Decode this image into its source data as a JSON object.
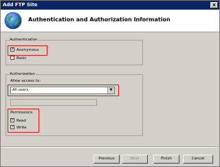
{
  "window": {
    "title": "Add FTP Site",
    "close_glyph": "x"
  },
  "header": {
    "title": "Authentication and Authorization Information",
    "icon": "globe-icon"
  },
  "authentication": {
    "group_label": "Authentication",
    "anonymous": {
      "label": "Anonymous",
      "checked": true
    },
    "basic": {
      "label": "Basic",
      "checked": false
    }
  },
  "authorization": {
    "group_label": "Authorization",
    "allow_access_label": "Allow access to:",
    "allow_access_value": "All users",
    "permissions_label": "Permissions",
    "read": {
      "label": "Read",
      "checked": true
    },
    "write": {
      "label": "Write",
      "checked": true
    }
  },
  "footer": {
    "previous": "Previous",
    "next": "Next",
    "finish": "Finish",
    "cancel": "Cancel"
  },
  "colors": {
    "highlight_red": "#e01818",
    "titlebar": "#0a246a"
  },
  "check_glyph": "✓",
  "dropdown_glyph": "▼"
}
